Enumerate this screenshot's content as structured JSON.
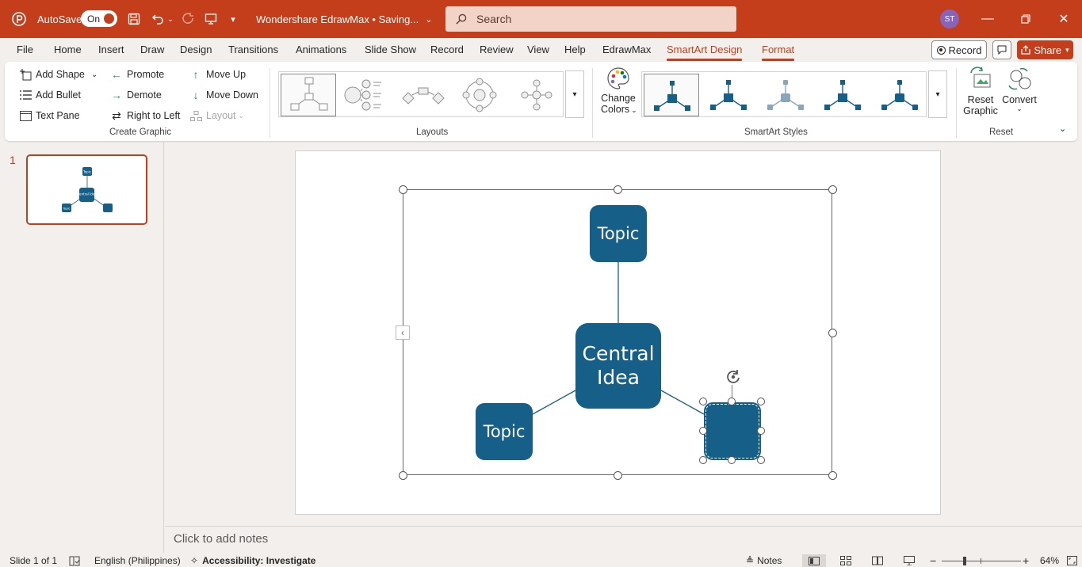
{
  "titlebar": {
    "autosave_label": "AutoSave",
    "autosave_state": "On",
    "doc_title": "Wondershare EdrawMax • Saving...",
    "search_placeholder": "Search",
    "user_initials": "ST",
    "bg_color": "#c43e1c"
  },
  "menu": {
    "tabs": [
      "File",
      "Home",
      "Insert",
      "Draw",
      "Design",
      "Transitions",
      "Animations",
      "Slide Show",
      "Record",
      "Review",
      "View",
      "Help",
      "EdrawMax",
      "SmartArt Design",
      "Format"
    ],
    "active_tab": "SmartArt Design",
    "record_label": "Record",
    "share_label": "Share"
  },
  "ribbon": {
    "create_graphic": {
      "label": "Create Graphic",
      "add_shape": "Add Shape",
      "add_bullet": "Add Bullet",
      "text_pane": "Text Pane",
      "promote": "Promote",
      "demote": "Demote",
      "right_to_left": "Right to Left",
      "move_up": "Move Up",
      "move_down": "Move Down",
      "layout": "Layout"
    },
    "layouts": {
      "label": "Layouts"
    },
    "smartart_styles": {
      "label": "SmartArt Styles",
      "change_colors_line1": "Change",
      "change_colors_line2": "Colors"
    },
    "reset": {
      "label": "Reset",
      "reset_line1": "Reset",
      "reset_line2": "Graphic",
      "convert": "Convert"
    }
  },
  "slides_panel": {
    "slide_number": "1",
    "thumb_center": "Central Idea",
    "thumb_topic": "Topic"
  },
  "diagram": {
    "top_node": "Topic",
    "center_line1": "Central",
    "center_line2": "Idea",
    "left_node": "Topic",
    "right_node": "",
    "node_color": "#155f88"
  },
  "notes": {
    "placeholder": "Click to add notes"
  },
  "status": {
    "slide_info": "Slide 1 of 1",
    "language": "English (Philippines)",
    "accessibility": "Accessibility: Investigate",
    "notes_label": "Notes",
    "zoom": "64%"
  }
}
